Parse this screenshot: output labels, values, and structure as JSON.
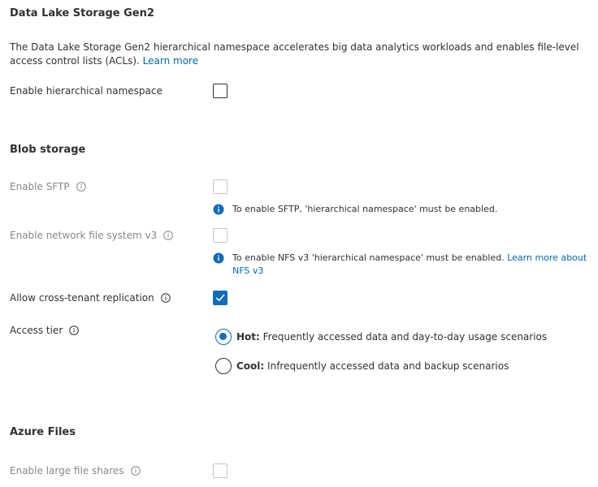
{
  "data_lake": {
    "title": "Data Lake Storage Gen2",
    "description": "The Data Lake Storage Gen2 hierarchical namespace accelerates big data analytics workloads and enables file-level access control lists (ACLs).",
    "learn_more": "Learn more",
    "hns_label": "Enable hierarchical namespace",
    "hns_checked": false
  },
  "blob": {
    "title": "Blob storage",
    "sftp_label": "Enable SFTP",
    "sftp_notice": "To enable SFTP, 'hierarchical namespace' must be enabled.",
    "nfs_label": "Enable network file system v3",
    "nfs_notice": "To enable NFS v3 'hierarchical namespace' must be enabled.",
    "nfs_learn_more": "Learn more about NFS v3",
    "cross_tenant_label": "Allow cross-tenant replication",
    "cross_tenant_checked": true,
    "access_tier_label": "Access tier",
    "tiers": [
      {
        "name": "Hot:",
        "description": "Frequently accessed data and day-to-day usage scenarios",
        "selected": true
      },
      {
        "name": "Cool:",
        "description": "Infrequently accessed data and backup scenarios",
        "selected": false
      }
    ]
  },
  "files": {
    "title": "Azure Files",
    "large_shares_label": "Enable large file shares"
  },
  "colors": {
    "accent": "#0f6cbd",
    "link": "#0066b8",
    "disabled_text": "#8a8886",
    "disabled_border": "#c8c6c4"
  },
  "icons": {
    "info": "info-circle-icon",
    "notice": "info-filled-icon",
    "check": "checkmark-icon"
  }
}
